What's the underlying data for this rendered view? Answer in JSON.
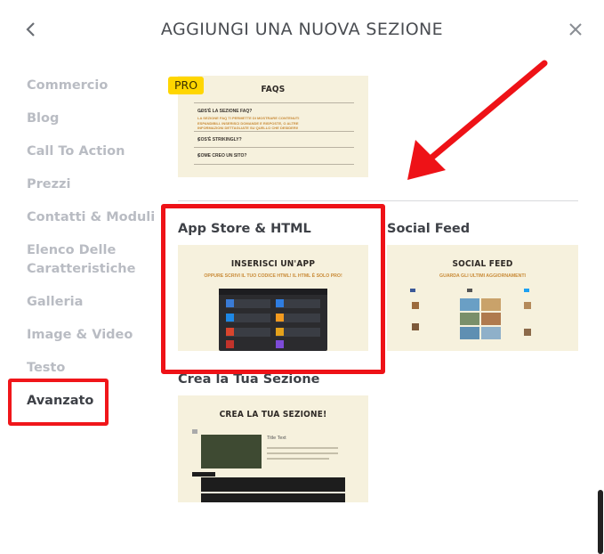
{
  "header": {
    "title": "AGGIUNGI UNA NUOVA SEZIONE"
  },
  "sidebar": {
    "items": [
      {
        "label": "Commercio"
      },
      {
        "label": "Blog"
      },
      {
        "label": "Call To Action"
      },
      {
        "label": "Prezzi"
      },
      {
        "label": "Contatti & Moduli"
      },
      {
        "label": "Elenco Delle Caratteristiche"
      },
      {
        "label": "Galleria"
      },
      {
        "label": "Image & Video"
      },
      {
        "label": "Testo"
      },
      {
        "label": "Avanzato"
      }
    ],
    "active_index": 9
  },
  "cards": {
    "faqs": {
      "badge": "PRO",
      "heading": "FAQS",
      "q1": "COS'È LA SEZIONE FAQ?",
      "a1": "LA SEZIONE FAQ TI PERMETTE DI MOSTRARE CONTENUTI ESPANDIBILI. INSERISCI DOMANDE E RISPOSTE, O ALTRE INFORMAZIONI DETTAGLIATE SU QUELLO CHE DESIDERI!",
      "q2": "COS'È STRIKINGLY?",
      "q3": "COME CREO UN SITO?"
    },
    "app_store": {
      "title": "App Store & HTML",
      "heading": "INSERISCI UN'APP",
      "sub": "OPPURE SCRIVI IL TUO CODICE HTML! IL HTML È SOLO PRO!"
    },
    "social_feed": {
      "title": "Social Feed",
      "heading": "SOCIAL FEED",
      "sub": "GUARDA GLI ULTIMI AGGIORNAMENTI"
    },
    "custom": {
      "title": "Crea la Tua Sezione",
      "heading": "CREA LA TUA SEZIONE!",
      "sample_title": "Title Text"
    }
  },
  "colors": {
    "accent_red": "#ee1217",
    "pro_yellow": "#ffd600",
    "thumb_bg": "#f6f1dd"
  }
}
